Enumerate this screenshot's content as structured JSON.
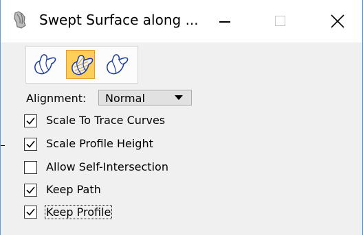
{
  "window": {
    "title": "Swept Surface along ...",
    "icon": "swept-surface-app-icon",
    "controls": {
      "minimize": "minimize-icon",
      "maximize": "maximize-icon",
      "close": "✕"
    }
  },
  "modes": [
    {
      "name": "mode-1",
      "icon": "surface-outline-icon",
      "selected": false
    },
    {
      "name": "mode-2",
      "icon": "surface-filled-icon",
      "selected": true
    },
    {
      "name": "mode-3",
      "icon": "surface-outline-icon",
      "selected": false
    }
  ],
  "alignment": {
    "label": "Alignment:",
    "value": "Normal"
  },
  "options": [
    {
      "label": "Scale To Trace Curves",
      "checked": true
    },
    {
      "label": "Scale Profile Height",
      "checked": true
    },
    {
      "label": "Allow Self-Intersection",
      "checked": false
    },
    {
      "label": "Keep Path",
      "checked": true
    },
    {
      "label": "Keep Profile",
      "checked": true
    }
  ],
  "colors": {
    "accent": "#3c8ad8",
    "selected_mode": "#ffcf5c",
    "icon_stroke": "#1a3ca0"
  }
}
